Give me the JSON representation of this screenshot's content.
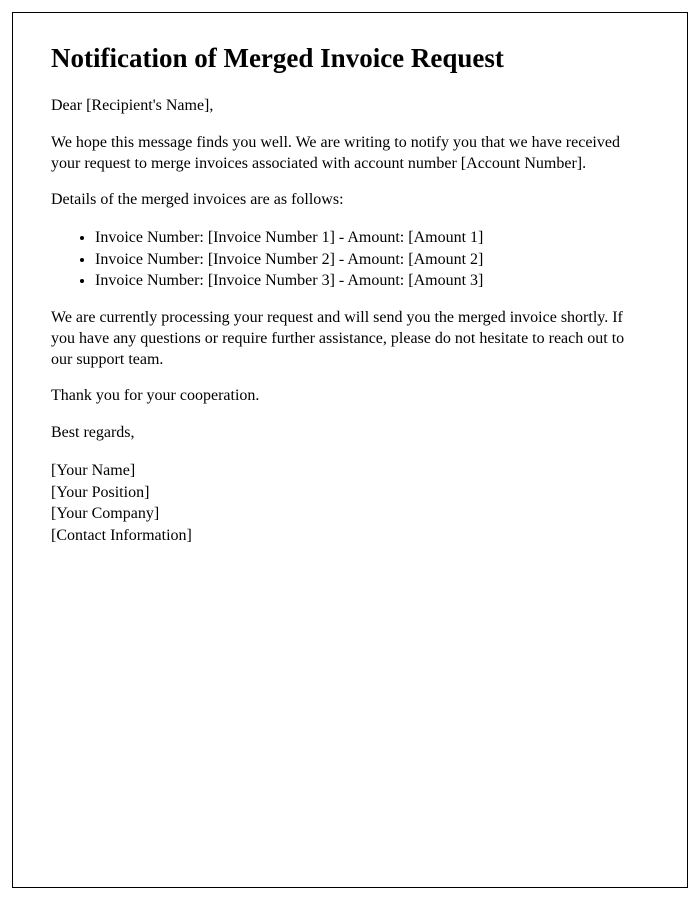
{
  "title": "Notification of Merged Invoice Request",
  "greeting": "Dear [Recipient's Name],",
  "intro": "We hope this message finds you well. We are writing to notify you that we have received your request to merge invoices associated with account number [Account Number].",
  "details_label": "Details of the merged invoices are as follows:",
  "invoices": [
    "Invoice Number: [Invoice Number 1] - Amount: [Amount 1]",
    "Invoice Number: [Invoice Number 2] - Amount: [Amount 2]",
    "Invoice Number: [Invoice Number 3] - Amount: [Amount 3]"
  ],
  "processing": "We are currently processing your request and will send you the merged invoice shortly. If you have any questions or require further assistance, please do not hesitate to reach out to our support team.",
  "thanks": "Thank you for your cooperation.",
  "closing": "Best regards,",
  "signature": {
    "name": "[Your Name]",
    "position": "[Your Position]",
    "company": "[Your Company]",
    "contact": "[Contact Information]"
  }
}
